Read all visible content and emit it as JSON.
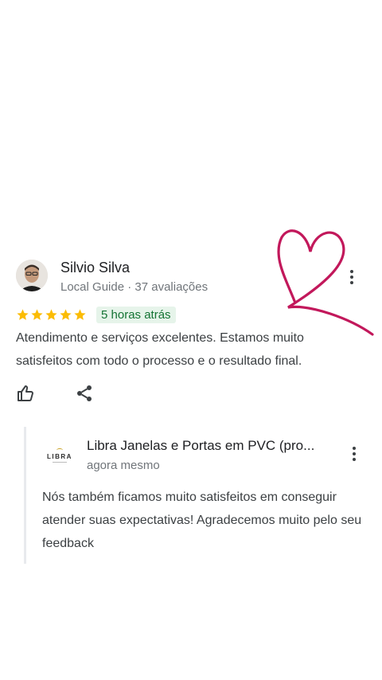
{
  "review": {
    "author": "Silvio Silva",
    "meta": "Local Guide · 37 avaliações",
    "rating": 5,
    "time_badge": "5 horas atrás",
    "text": "Atendimento e serviços excelentes. Estamos muito satisfeitos com todo o processo e o resultado final.",
    "star_color": "#fbbc04"
  },
  "reply": {
    "logo_text": "LIBRA",
    "business_name": "Libra Janelas e Portas em PVC (pro...",
    "time": "agora mesmo",
    "text": "Nós também ficamos muito satisfeitos em conseguir atender suas expectativas! Agradecemos muito pelo seu feedback"
  },
  "colors": {
    "heart": "#c2185b",
    "badge_bg": "#e6f4ea",
    "badge_text": "#137333"
  }
}
